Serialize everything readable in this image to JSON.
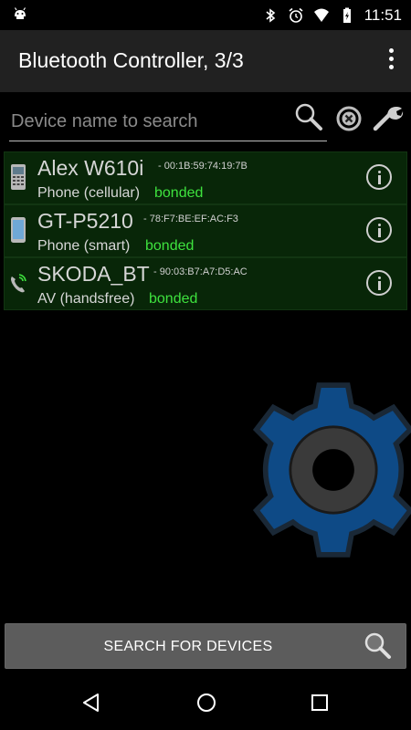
{
  "status_bar": {
    "time": "11:51",
    "icons": [
      "android-icon",
      "bluetooth-icon",
      "alarm-icon",
      "wifi-icon",
      "battery-icon"
    ]
  },
  "app_bar": {
    "title": "Bluetooth Controller, 3/3",
    "menu_icon": "overflow-menu-icon"
  },
  "search": {
    "placeholder": "Device name to search",
    "value": ""
  },
  "devices": [
    {
      "name": "Alex W610i",
      "address": "- 00:1B:59:74:19:7B",
      "type": "Phone (cellular)",
      "status": "bonded",
      "icon": "cellphone-icon"
    },
    {
      "name": "GT-P5210",
      "address": "- 78:F7:BE:EF:AC:F3",
      "type": "Phone (smart)",
      "status": "bonded",
      "icon": "smartphone-icon"
    },
    {
      "name": "SKODA_BT",
      "address": "- 90:03:B7:A7:D5:AC",
      "type": "AV (handsfree)",
      "status": "bonded",
      "icon": "handsfree-phone-icon"
    }
  ],
  "search_button": {
    "label": "SEARCH FOR DEVICES",
    "icon": "magnifier-icon"
  },
  "colors": {
    "device_bg": "#082608",
    "status_bonded": "#3ee23e",
    "gear_blue": "#0e4a86",
    "gear_dark": "#3a3a3a"
  },
  "nav_bar": {
    "icons": [
      "back-icon",
      "home-icon",
      "recents-icon"
    ]
  }
}
